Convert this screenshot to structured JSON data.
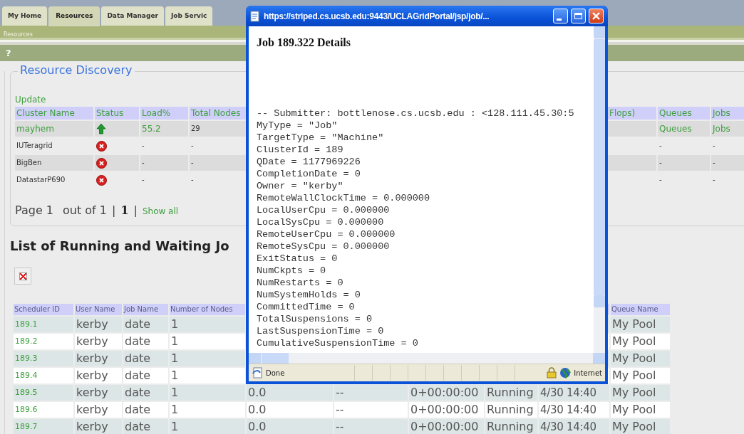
{
  "tabs": [
    {
      "label": "My Home",
      "selected": false
    },
    {
      "label": "Resources",
      "selected": true
    },
    {
      "label": "Data Manager",
      "selected": false
    },
    {
      "label": "Job Servic",
      "selected": false
    }
  ],
  "breadcrumb": "Resources",
  "help_bar": {
    "label": "?"
  },
  "resource_discovery": {
    "title": "Resource Discovery",
    "update_link": "Update",
    "columns": {
      "cluster_name": "Cluster Name",
      "status": "Status",
      "load": "Load%",
      "total_nodes": "Total Nodes",
      "column_5": "Flops)",
      "queues": "Queues",
      "jobs": "Jobs"
    },
    "rows": [
      {
        "cluster_name": "mayhem",
        "linked": true,
        "online": true,
        "load": "55.2",
        "total_nodes": "29",
        "queues": "Queues",
        "jobs": "Jobs"
      },
      {
        "cluster_name": "IUTeragrid",
        "linked": false,
        "online": false,
        "load": "-",
        "total_nodes": "-",
        "queues": "-",
        "jobs": "-"
      },
      {
        "cluster_name": "BigBen",
        "linked": false,
        "online": false,
        "load": "-",
        "total_nodes": "-",
        "queues": "-",
        "jobs": "-"
      },
      {
        "cluster_name": "DatastarP690",
        "linked": false,
        "online": false,
        "load": "-",
        "total_nodes": "-",
        "queues": "-",
        "jobs": "-"
      }
    ]
  },
  "pagination": {
    "page": "Page 1",
    "out_of": "out of 1",
    "separator_1": "|",
    "current": "1",
    "separator_2": "|",
    "show_all": "Show all"
  },
  "jobs": {
    "title": "List of Running and Waiting Jo",
    "columns": {
      "scheduler_id": "Scheduler ID",
      "user_name": "User Name",
      "job_name": "Job Name",
      "number_of_nodes": "Number of Nodes",
      "queue_name": "Queue Name"
    },
    "rows": [
      {
        "scheduler_id": "189.1",
        "user_name": "kerby",
        "job_name": "date",
        "number_of_nodes": "1",
        "queue_name": "My Pool"
      },
      {
        "scheduler_id": "189.2",
        "user_name": "kerby",
        "job_name": "date",
        "number_of_nodes": "1",
        "queue_name": "My Pool"
      },
      {
        "scheduler_id": "189.3",
        "user_name": "kerby",
        "job_name": "date",
        "number_of_nodes": "1",
        "queue_name": "My Pool"
      },
      {
        "scheduler_id": "189.4",
        "user_name": "kerby",
        "job_name": "date",
        "number_of_nodes": "1",
        "queue_name": "My Pool"
      },
      {
        "scheduler_id": "189.5",
        "user_name": "kerby",
        "job_name": "date",
        "number_of_nodes": "1",
        "column_5": "0.0",
        "column_6": "--",
        "column_7": "0+00:00:00",
        "column_8": "Running",
        "column_9": "4/30 14:40",
        "queue_name": "My Pool"
      },
      {
        "scheduler_id": "189.6",
        "user_name": "kerby",
        "job_name": "date",
        "number_of_nodes": "1",
        "column_5": "0.0",
        "column_6": "--",
        "column_7": "0+00:00:00",
        "column_8": "Running",
        "column_9": "4/30 14:40",
        "queue_name": "My Pool"
      },
      {
        "scheduler_id": "189.7",
        "user_name": "kerby",
        "job_name": "date",
        "number_of_nodes": "1",
        "column_5": "0.0",
        "column_6": "--",
        "column_7": "0+00:00:00",
        "column_8": "Running",
        "column_9": "4/30 14:40",
        "queue_name": "My Pool"
      }
    ]
  },
  "popup": {
    "title": "https://striped.cs.ucsb.edu:9443/UCLAGridPortal/jsp/job/...",
    "heading": "Job 189.322 Details",
    "lines": [
      "-- Submitter: bottlenose.cs.ucsb.edu : <128.111.45.30:5",
      "MyType = \"Job\"",
      "TargetType = \"Machine\"",
      "ClusterId = 189",
      "QDate = 1177969226",
      "CompletionDate = 0",
      "Owner = \"kerby\"",
      "RemoteWallClockTime = 0.000000",
      "LocalUserCpu = 0.000000",
      "LocalSysCpu = 0.000000",
      "RemoteUserCpu = 0.000000",
      "RemoteSysCpu = 0.000000",
      "ExitStatus = 0",
      "NumCkpts = 0",
      "NumRestarts = 0",
      "NumSystemHolds = 0",
      "CommittedTime = 0",
      "TotalSuspensions = 0",
      "LastSuspensionTime = 0",
      "CumulativeSuspensionTime = 0"
    ],
    "status": "Done",
    "zone": "Internet"
  }
}
